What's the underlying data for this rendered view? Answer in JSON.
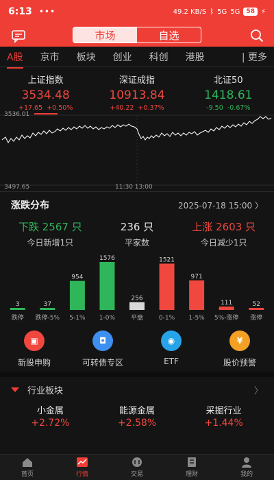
{
  "status": {
    "time": "6:13",
    "dots": "•••",
    "net": "49.2 KB/S",
    "sig1": "5G",
    "sig2": "5G",
    "battery": "58"
  },
  "header": {
    "tab_market": "市场",
    "tab_watch": "自选"
  },
  "market_tabs": [
    "A股",
    "京市",
    "板块",
    "创业",
    "科创",
    "港股"
  ],
  "more": "| 更多",
  "indices": [
    {
      "name": "上证指数",
      "price": "3534.48",
      "change": "+17.65",
      "pct": "+0.50%"
    },
    {
      "name": "深证成指",
      "price": "10913.84",
      "change": "+40.22",
      "pct": "+0.37%"
    },
    {
      "name": "北证50",
      "price": "1418.61",
      "change": "-9.50",
      "pct": "-0.67%"
    }
  ],
  "intraday": {
    "high_label": "3536.01",
    "low_label": "3497.65",
    "mid_label": "11:30 13:00"
  },
  "distribution": {
    "title": "涨跌分布",
    "date": "2025-07-18 15:00 〉",
    "down_label": "下跌",
    "down_count": "2567",
    "down_unit": "只",
    "down_sub": "今日新增1只",
    "flat_count": "236",
    "flat_unit": "只",
    "flat_sub": "平家数",
    "up_label": "上涨",
    "up_count": "2603",
    "up_unit": "只",
    "up_sub": "今日减少1只"
  },
  "chart_data": {
    "type": "bar",
    "categories": [
      "跌停",
      "跌停-5%",
      "5-1%",
      "1-0%",
      "平盘",
      "0-1%",
      "1-5%",
      "5%-涨停",
      "涨停"
    ],
    "values": [
      3,
      37,
      954,
      1576,
      256,
      1521,
      971,
      111,
      52
    ],
    "colors": [
      "#2fb55a",
      "#2fb55a",
      "#2fb55a",
      "#2fb55a",
      "#d8d8d8",
      "#f0473e",
      "#f0473e",
      "#f0473e",
      "#f0473e"
    ]
  },
  "shortcuts": [
    {
      "label": "新股申购",
      "color": "#f0473e",
      "glyph": "▣"
    },
    {
      "label": "可转债专区",
      "color": "#3d8ff0",
      "glyph": "◘"
    },
    {
      "label": "ETF",
      "color": "#27a3e8",
      "glyph": "◉"
    },
    {
      "label": "股价预警",
      "color": "#f3a024",
      "glyph": "¥"
    }
  ],
  "sector": {
    "title": "行业板块",
    "arrow": "〉"
  },
  "sectors": [
    {
      "name": "小金属",
      "change": "+2.72%"
    },
    {
      "name": "能源金属",
      "change": "+2.58%"
    },
    {
      "name": "采掘行业",
      "change": "+1.44%"
    }
  ],
  "nav": [
    "首页",
    "行情",
    "交易",
    "理财",
    "我的"
  ]
}
